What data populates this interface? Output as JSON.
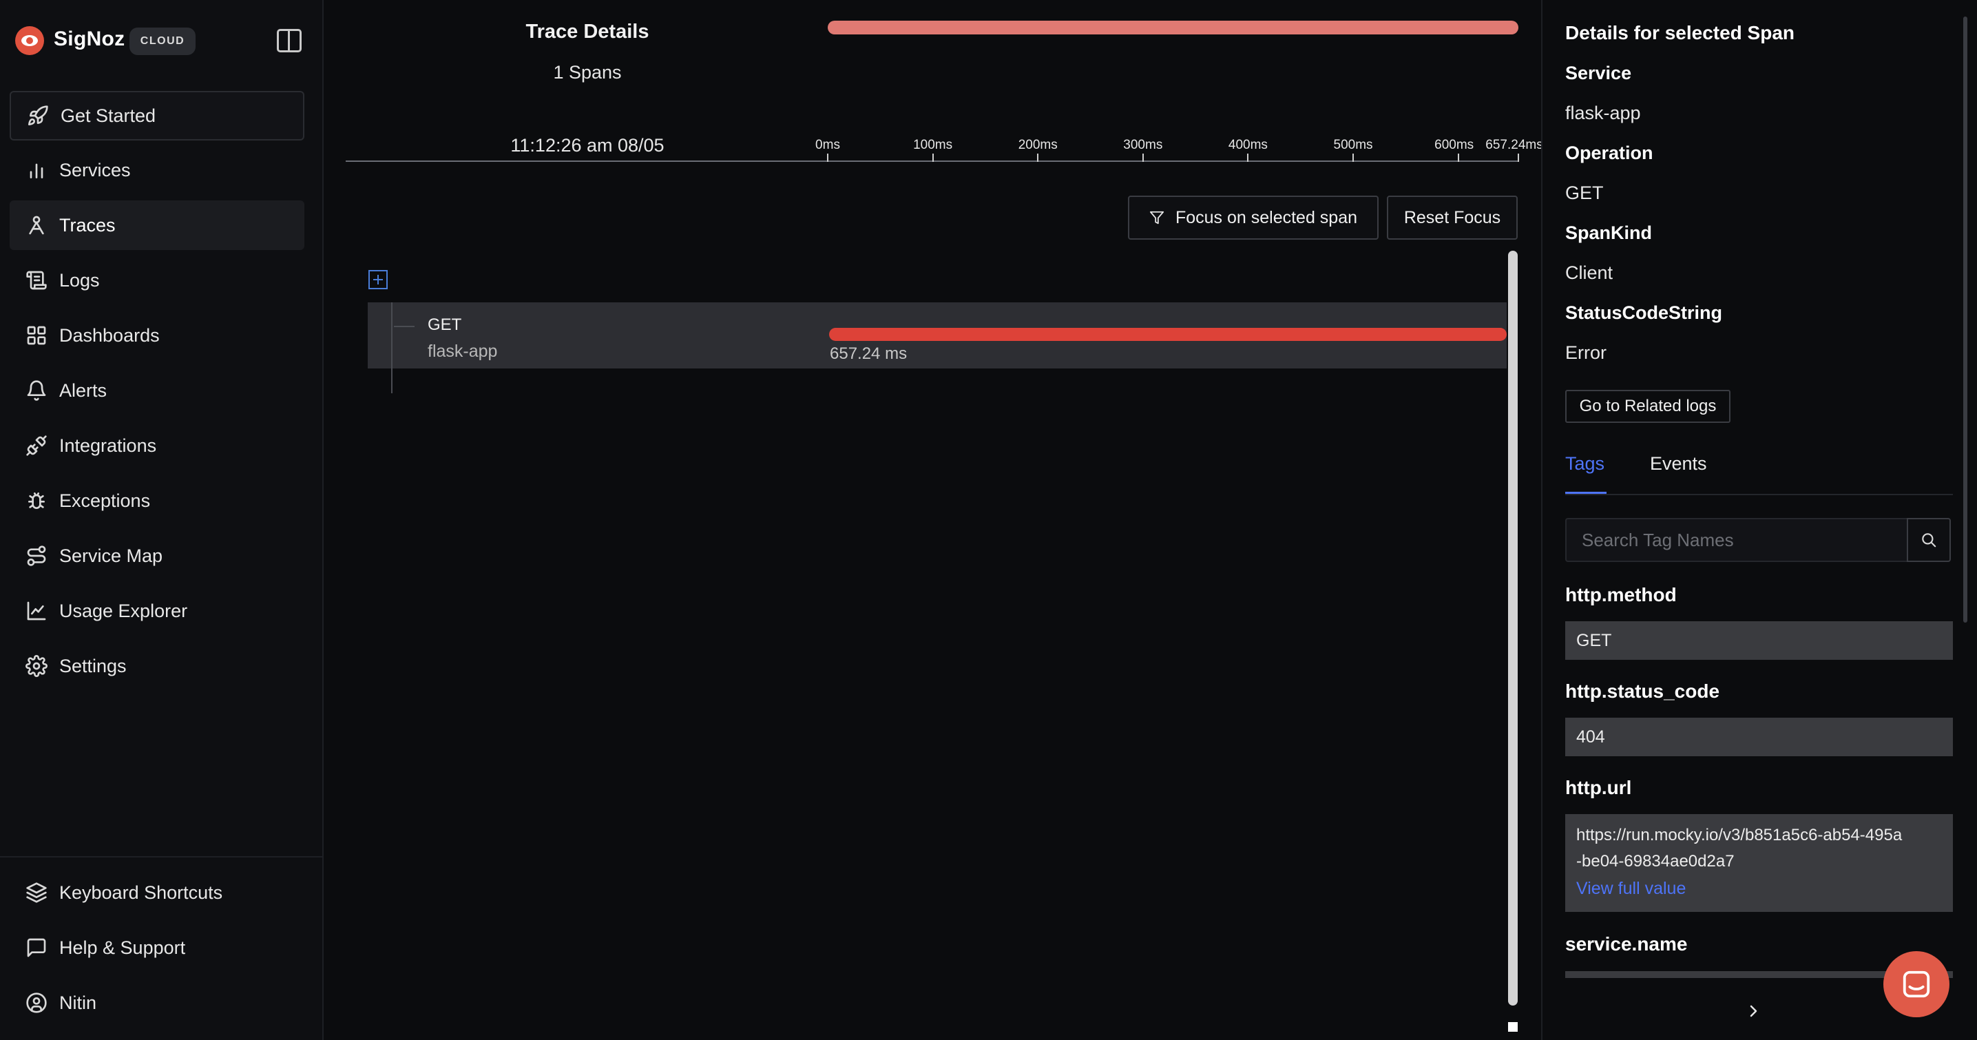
{
  "sidebar": {
    "brand": "SigNoz",
    "badge": "CLOUD",
    "items": [
      {
        "label": "Get Started",
        "icon": "rocket-icon"
      },
      {
        "label": "Services",
        "icon": "bar-chart-icon"
      },
      {
        "label": "Traces",
        "icon": "route-icon"
      },
      {
        "label": "Logs",
        "icon": "scroll-text-icon"
      },
      {
        "label": "Dashboards",
        "icon": "layout-grid-icon"
      },
      {
        "label": "Alerts",
        "icon": "bell-icon"
      },
      {
        "label": "Integrations",
        "icon": "plug-icon"
      },
      {
        "label": "Exceptions",
        "icon": "bug-icon"
      },
      {
        "label": "Service Map",
        "icon": "route-map-icon"
      },
      {
        "label": "Usage Explorer",
        "icon": "line-chart-icon"
      },
      {
        "label": "Settings",
        "icon": "gear-icon"
      }
    ],
    "bottom_items": [
      {
        "label": "Keyboard Shortcuts",
        "icon": "layers-icon"
      },
      {
        "label": "Help & Support",
        "icon": "message-square-icon"
      },
      {
        "label": "Nitin",
        "icon": "user-circle-icon"
      }
    ],
    "active_item": "Traces"
  },
  "trace": {
    "title": "Trace Details",
    "spans_count": "1 Spans",
    "start_time": "11:12:26 am 08/05",
    "axis_ticks": [
      "0ms",
      "100ms",
      "200ms",
      "300ms",
      "400ms",
      "500ms",
      "600ms",
      "657.24ms"
    ],
    "axis_max_ms": 657.24,
    "focus_button": "Focus on selected span",
    "reset_button": "Reset Focus",
    "span": {
      "operation": "GET",
      "service": "flask-app",
      "duration": "657.24 ms",
      "duration_ms": 657.24,
      "bar_color": "#dd4238"
    }
  },
  "details": {
    "title": "Details for selected Span",
    "fields": [
      {
        "label": "Service",
        "value": "flask-app"
      },
      {
        "label": "Operation",
        "value": "GET"
      },
      {
        "label": "SpanKind",
        "value": "Client"
      },
      {
        "label": "StatusCodeString",
        "value": "Error"
      }
    ],
    "related_logs_button": "Go to Related logs",
    "tabs": [
      {
        "label": "Tags",
        "active": true
      },
      {
        "label": "Events",
        "active": false
      }
    ],
    "accent_color": "#4e74f8",
    "search_placeholder": "Search Tag Names",
    "tags": [
      {
        "key": "http.method",
        "value": "GET"
      },
      {
        "key": "http.status_code",
        "value": "404"
      },
      {
        "key": "http.url",
        "value_line1": "https://run.mocky.io/v3/b851a5c6-ab54-495a",
        "value_line2": "-be04-69834ae0d2a7",
        "view_full": "View full value"
      },
      {
        "key": "service.name"
      }
    ]
  }
}
